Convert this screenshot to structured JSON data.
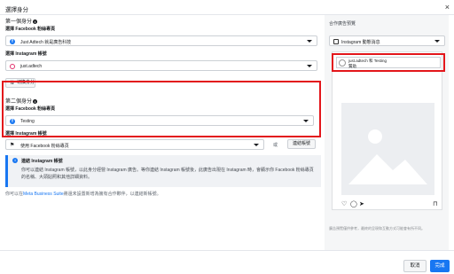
{
  "dialog": {
    "title": "選擇身分"
  },
  "first_identity": {
    "heading": "第一個身分",
    "fb_label": "選擇 Facebook 粉絲專頁",
    "fb_value": "Just Adtech 就是廣告科技",
    "ig_label": "選擇 Instagram 帳號",
    "ig_value": "just.adtech"
  },
  "switch_button": "切換身分",
  "second_identity": {
    "heading": "第二個身分",
    "fb_label": "選擇 Facebook 粉絲專頁",
    "fb_value": "Testing",
    "ig_label": "選擇 Instagram 帳號",
    "ig_value": "使用 Facebook 粉絲專頁",
    "or_text": "或",
    "link_button": "連結帳號"
  },
  "info_box": {
    "title": "連結 Instagram 帳號",
    "body": "你可以連結 Instagram 帳號，以此身分經營 Instagram 廣告。等你連結 Instagram 帳號後，此廣告出現在 Instagram 時，會顯示你 Facebook 粉絲專頁的名稱、大頭貼照和其他詳細資料。"
  },
  "footnote": {
    "prefix": "你可以在",
    "link": "Meta Business Suite",
    "suffix": "將還未設置新增為擁有合作夥伴，以連結新帳號。"
  },
  "preview": {
    "title": "合作廣告預覽",
    "placement": "Instagram 動態消息",
    "account_name": "just.adtech 和 Testing",
    "account_sub": "贊助",
    "note": "廣告預覽僅供參考，最終的呈現和互動方式可能會有所不同。"
  },
  "footer": {
    "cancel": "取消",
    "done": "完成"
  },
  "colors": {
    "accent": "#1877f2",
    "highlight": "#e3161b"
  }
}
